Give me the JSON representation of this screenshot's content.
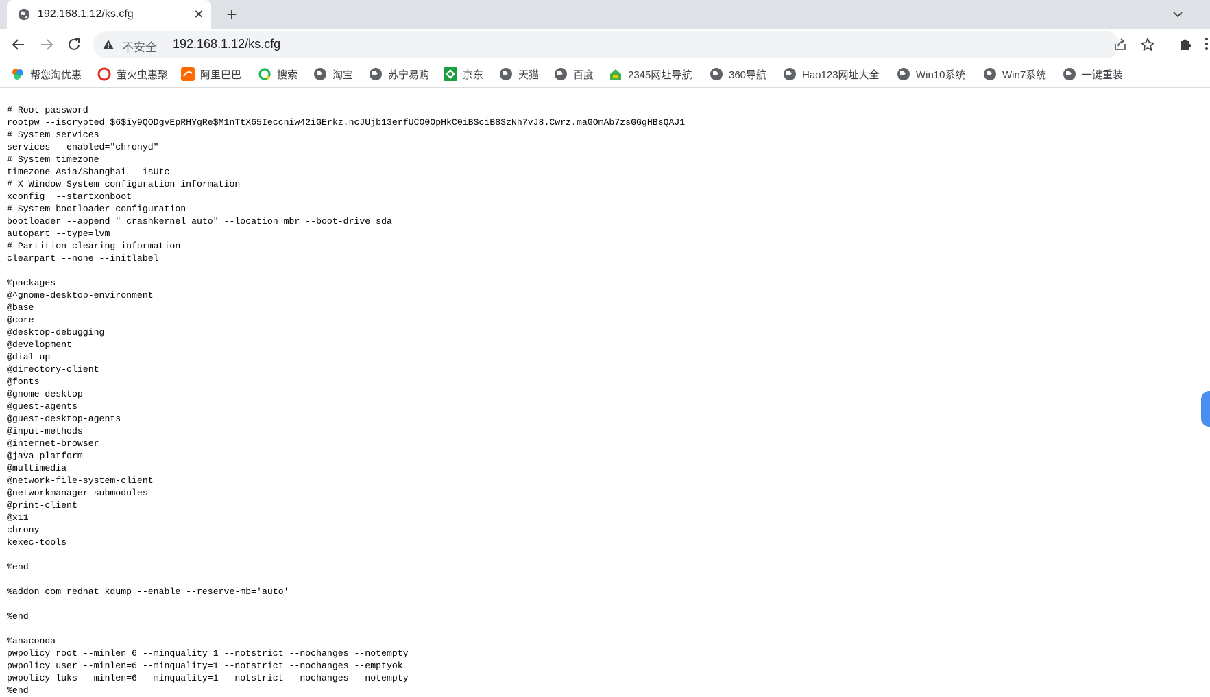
{
  "tab": {
    "title": "192.168.1.12/ks.cfg",
    "close_symbol": "✕"
  },
  "new_tab_symbol": "+",
  "address": {
    "security_label": "不安全",
    "url": "192.168.1.12/ks.cfg"
  },
  "bookmarks": [
    {
      "label": "帮您淘优惠",
      "icon": "taobao-deals-icon"
    },
    {
      "label": "萤火虫惠聚",
      "icon": "firefly-icon"
    },
    {
      "label": "阿里巴巴",
      "icon": "alibaba-icon"
    },
    {
      "label": "搜索",
      "icon": "360-search-icon"
    },
    {
      "label": "淘宝",
      "icon": "globe-icon"
    },
    {
      "label": "苏宁易购",
      "icon": "globe-icon"
    },
    {
      "label": "京东",
      "icon": "jd-icon"
    },
    {
      "label": "天猫",
      "icon": "globe-icon"
    },
    {
      "label": "百度",
      "icon": "globe-icon"
    },
    {
      "label": "2345网址导航",
      "icon": "2345-icon"
    },
    {
      "label": "360导航",
      "icon": "globe-icon"
    },
    {
      "label": "Hao123网址大全",
      "icon": "globe-icon"
    },
    {
      "label": "Win10系统",
      "icon": "globe-icon"
    },
    {
      "label": "Win7系统",
      "icon": "globe-icon"
    },
    {
      "label": "一键重装",
      "icon": "globe-icon"
    }
  ],
  "content_lines": [
    "# Root password",
    "rootpw --iscrypted $6$iy9QODgvEpRHYgRe$M1nTtX65Ieccniw42iGErkz.ncJUjb13erfUCO0OpHkC0iBSciB8SzNh7vJ8.Cwrz.maGOmAb7zsGGgHBsQAJ1",
    "# System services",
    "services --enabled=\"chronyd\"",
    "# System timezone",
    "timezone Asia/Shanghai --isUtc",
    "# X Window System configuration information",
    "xconfig  --startxonboot",
    "# System bootloader configuration",
    "bootloader --append=\" crashkernel=auto\" --location=mbr --boot-drive=sda",
    "autopart --type=lvm",
    "# Partition clearing information",
    "clearpart --none --initlabel",
    "",
    "%packages",
    "@^gnome-desktop-environment",
    "@base",
    "@core",
    "@desktop-debugging",
    "@development",
    "@dial-up",
    "@directory-client",
    "@fonts",
    "@gnome-desktop",
    "@guest-agents",
    "@guest-desktop-agents",
    "@input-methods",
    "@internet-browser",
    "@java-platform",
    "@multimedia",
    "@network-file-system-client",
    "@networkmanager-submodules",
    "@print-client",
    "@x11",
    "chrony",
    "kexec-tools",
    "",
    "%end",
    "",
    "%addon com_redhat_kdump --enable --reserve-mb='auto'",
    "",
    "%end",
    "",
    "%anaconda",
    "pwpolicy root --minlen=6 --minquality=1 --notstrict --nochanges --notempty",
    "pwpolicy user --minlen=6 --minquality=1 --notstrict --nochanges --emptyok",
    "pwpolicy luks --minlen=6 --minquality=1 --notstrict --nochanges --notempty",
    "%end"
  ]
}
